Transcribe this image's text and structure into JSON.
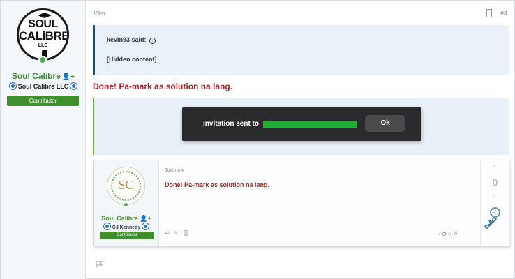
{
  "user": {
    "logo_line1": "SOUL",
    "logo_line2": "CALiBRE",
    "logo_line3": "LLC",
    "name": "Soul Calibre",
    "title": "Soul Calibre LLC",
    "banner": "Contributor"
  },
  "post": {
    "time": "19m",
    "number": "#4",
    "quote_author": "kevin93 said:",
    "quote_body": "[Hidden content]",
    "message": "Done! Pa-mark as solution na lang.",
    "partial_text": "a"
  },
  "dialog": {
    "message": "Invitation sent to",
    "ok_label": "Ok"
  },
  "embed": {
    "time": "Just now",
    "message": "Done! Pa-mark as solution na lang.",
    "user_name": "Soul Calibre",
    "user_title": "CJ Kennedy",
    "banner": "Contributor",
    "avatar_text": "SC",
    "vote_count": "0",
    "quote_actions": "+ Q   ♾ ↶"
  },
  "colors": {
    "accent_green": "#3f8f2e",
    "message_red": "#a52a2a",
    "quote_bg": "#eaf1f8",
    "redaction": "#1fae37"
  }
}
